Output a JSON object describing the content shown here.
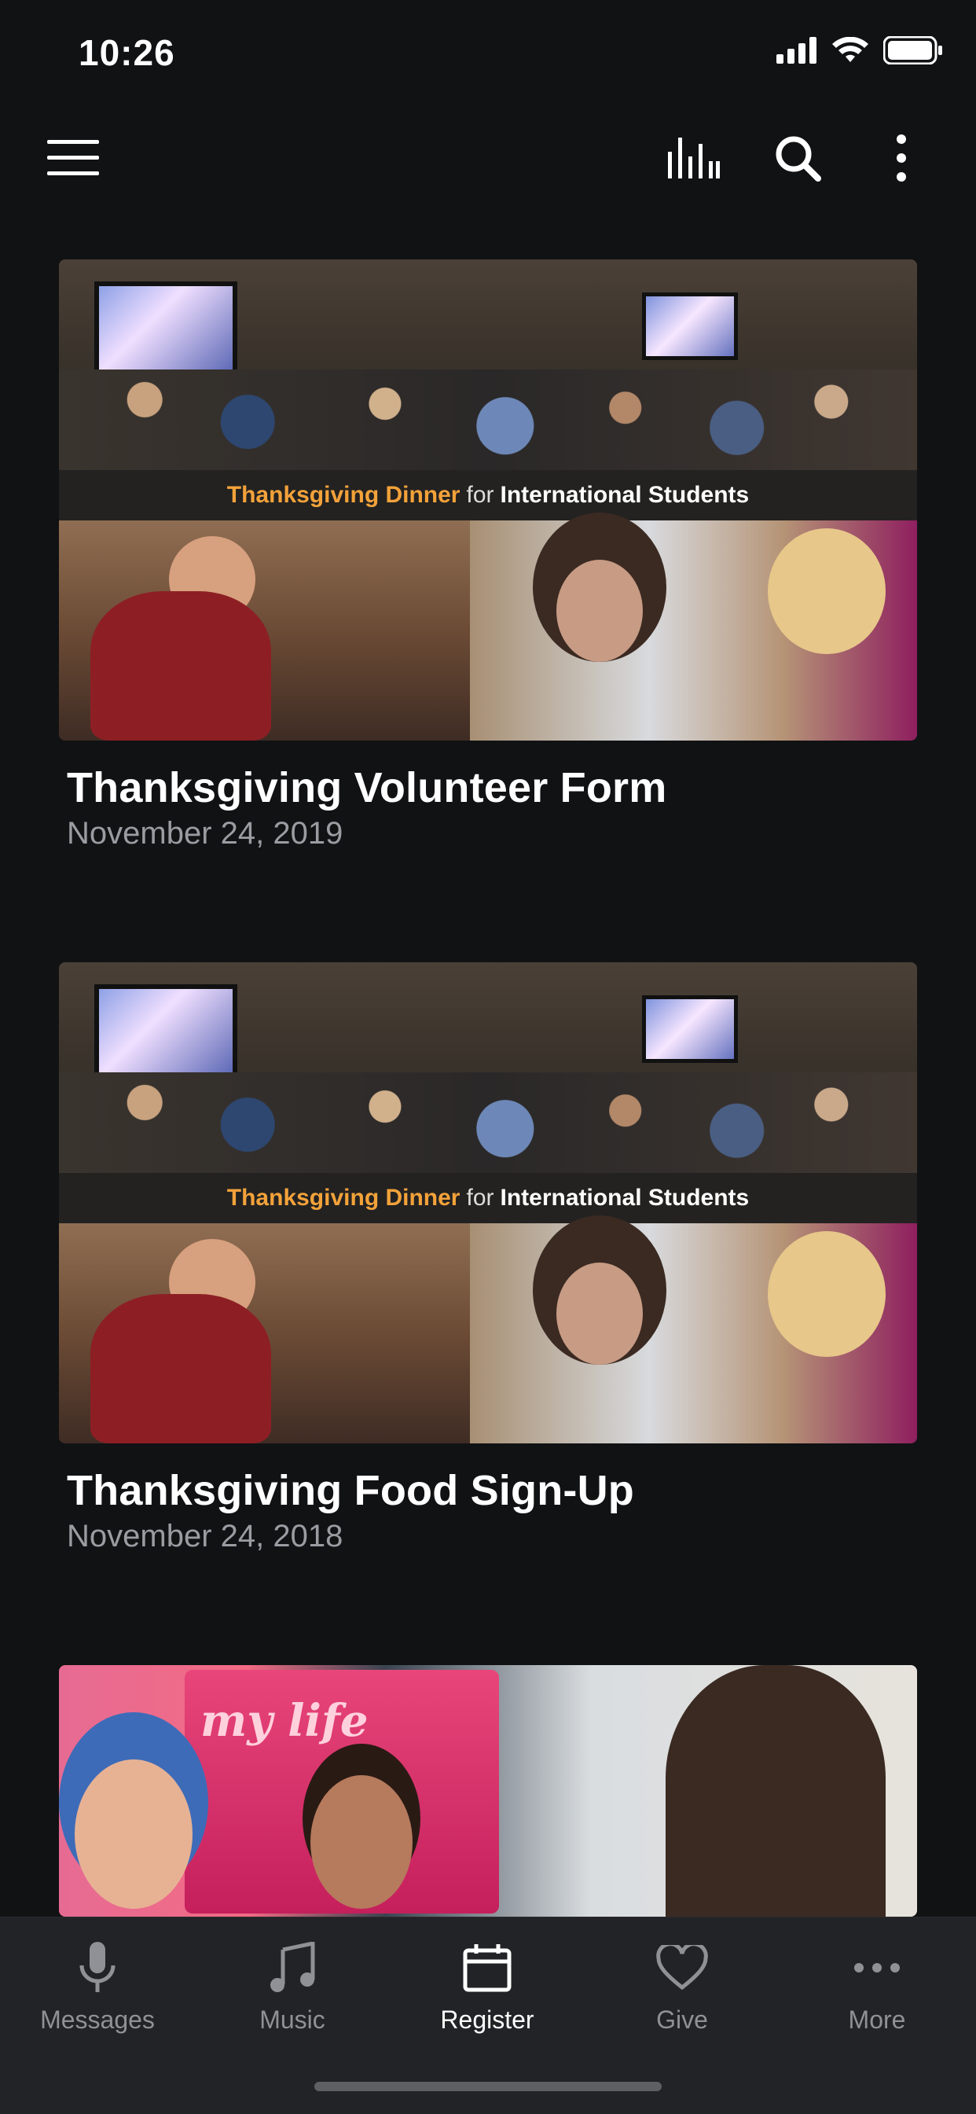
{
  "status_bar": {
    "time": "10:26"
  },
  "app_bar": {
    "icons": [
      "menu-icon",
      "audio-bars-icon",
      "search-icon",
      "more-vertical-icon"
    ]
  },
  "feed": {
    "items": [
      {
        "title": "Thanksgiving Volunteer Form",
        "date": "November 24, 2019",
        "banner": {
          "part1": "Thanksgiving Dinner",
          "part2": "for",
          "part3": "International Students"
        }
      },
      {
        "title": "Thanksgiving Food Sign-Up",
        "date": "November 24, 2018",
        "banner": {
          "part1": "Thanksgiving Dinner",
          "part2": "for",
          "part3": "International Students"
        }
      },
      {
        "image_text": "my life"
      }
    ]
  },
  "tab_bar": {
    "tabs": [
      {
        "label": "Messages",
        "icon": "microphone-icon",
        "active": false
      },
      {
        "label": "Music",
        "icon": "music-note-icon",
        "active": false
      },
      {
        "label": "Register",
        "icon": "calendar-icon",
        "active": true
      },
      {
        "label": "Give",
        "icon": "heart-icon",
        "active": false
      },
      {
        "label": "More",
        "icon": "more-horizontal-icon",
        "active": false
      }
    ]
  },
  "colors": {
    "background": "#111214",
    "tabbar": "#222326",
    "accent_orange": "#f3a23a",
    "inactive": "#8f9196"
  }
}
